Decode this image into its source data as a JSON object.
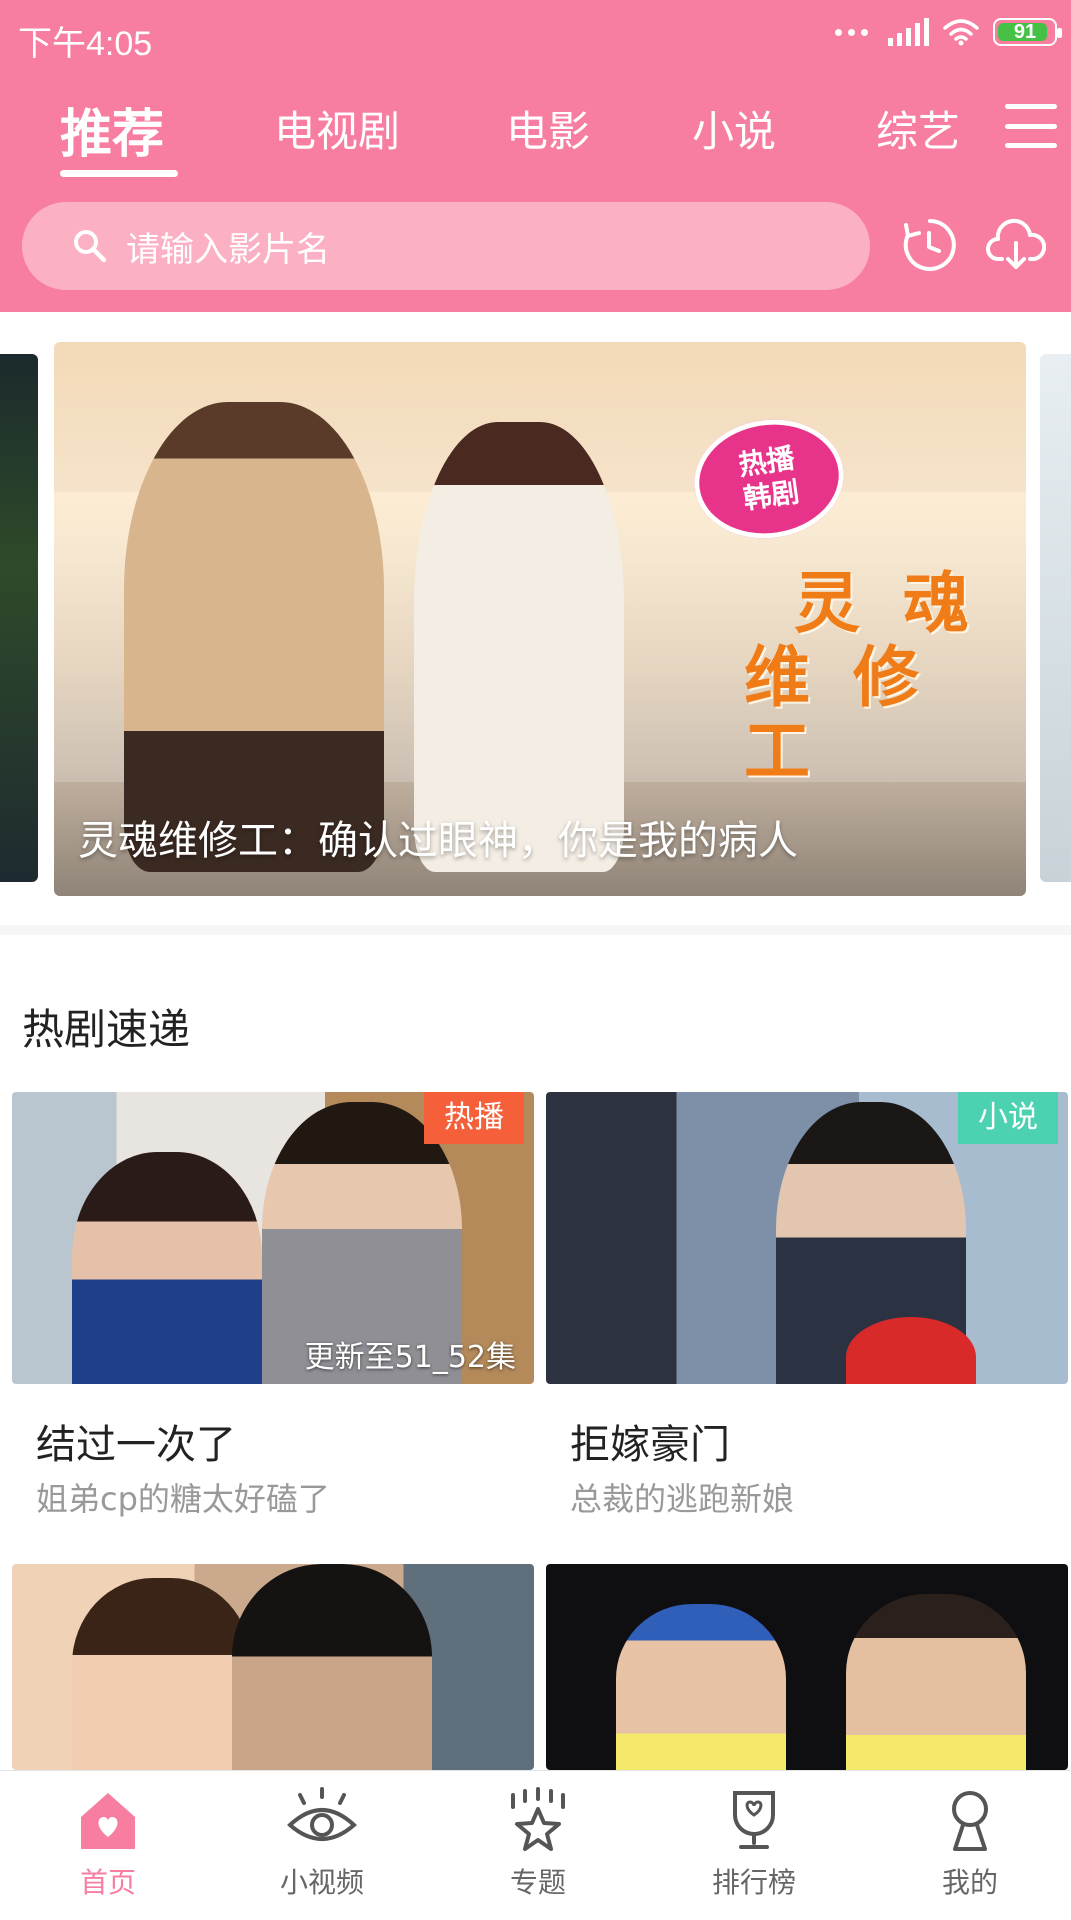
{
  "status_bar": {
    "time": "下午4:05",
    "battery": "91"
  },
  "tabs": [
    {
      "label": "推荐",
      "active": true
    },
    {
      "label": "电视剧",
      "active": false
    },
    {
      "label": "电影",
      "active": false
    },
    {
      "label": "小说",
      "active": false
    },
    {
      "label": "综艺",
      "active": false
    }
  ],
  "search": {
    "placeholder": "请输入影片名"
  },
  "banner": {
    "badge_line1": "热播",
    "badge_line2": "韩剧",
    "art_title_line1": "灵 魂",
    "art_title_line2": "维 修 工",
    "caption": "灵魂维修工：确认过眼神，你是我的病人"
  },
  "section": {
    "title": "热剧速递"
  },
  "cards": [
    {
      "title": "结过一次了",
      "subtitle": "姐弟cp的糖太好磕了",
      "tag": "热播",
      "update": "更新至51_52集"
    },
    {
      "title": "拒嫁豪门",
      "subtitle": "总裁的逃跑新娘",
      "tag": "小说",
      "update": ""
    },
    {
      "title": "",
      "subtitle": "",
      "tag": "",
      "update": ""
    },
    {
      "title": "",
      "subtitle": "",
      "tag": "",
      "update": ""
    }
  ],
  "bottom_nav": [
    {
      "label": "首页",
      "icon": "home-heart-icon",
      "active": true
    },
    {
      "label": "小视频",
      "icon": "eye-icon",
      "active": false
    },
    {
      "label": "专题",
      "icon": "star-icon",
      "active": false
    },
    {
      "label": "排行榜",
      "icon": "trophy-icon",
      "active": false
    },
    {
      "label": "我的",
      "icon": "person-icon",
      "active": false
    }
  ],
  "colors": {
    "brand": "#f77ea0",
    "hot_tag": "#f5603a",
    "novel_tag": "#4cd2b0"
  }
}
